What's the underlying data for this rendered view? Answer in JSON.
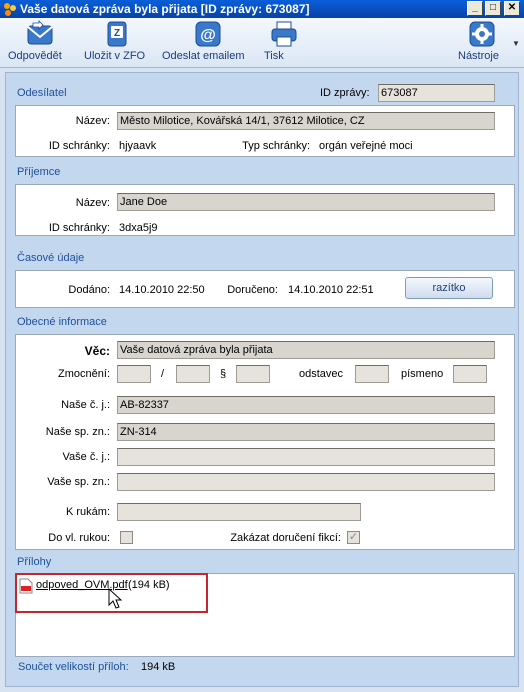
{
  "window": {
    "title": "Vaše datová zpráva byla přijata [ID zprávy: 673087]"
  },
  "toolbar": {
    "reply_label": "Odpovědět",
    "save_zfo_label": "Uložit v ZFO",
    "send_email_label": "Odeslat emailem",
    "print_label": "Tisk",
    "tools_label": "Nástroje"
  },
  "sender": {
    "section_label": "Odesílatel",
    "id_label": "ID zprávy:",
    "id_value": "673087",
    "name_label": "Název:",
    "name_value": "Město Milotice, Kovářská 14/1, 37612 Milotice, CZ",
    "box_label": "ID schránky:",
    "box_value": "hjyaavk",
    "box_type_label": "Typ schránky:",
    "box_type_value": "orgán veřejné moci"
  },
  "recipient": {
    "section_label": "Příjemce",
    "name_label": "Název:",
    "name_value": "Jane Doe",
    "box_label": "ID schránky:",
    "box_value": "3dxa5j9"
  },
  "time": {
    "section_label": "Časové údaje",
    "delivered_label": "Dodáno:",
    "delivered_value": "14.10.2010 22:50",
    "received_label": "Doručeno:",
    "received_value": "14.10.2010 22:51",
    "stamp_button": "razítko"
  },
  "general": {
    "section_label": "Obecné informace",
    "subject_label": "Věc:",
    "subject_value": "Vaše datová zpráva byla přijata",
    "authorization_label": "Zmocnění:",
    "slash": "/",
    "paragraph": "§",
    "subsection_label": "odstavec",
    "letter_label": "písmeno",
    "our_ref_label": "Naše č. j.:",
    "our_ref_value": "AB-82337",
    "our_file_label": "Naše sp. zn.:",
    "our_file_value": "ZN-314",
    "your_ref_label": "Vaše č. j.:",
    "your_file_label": "Vaše sp. zn.:",
    "attn_label": "K rukám:",
    "personal_label": "Do vl. rukou:",
    "fiction_label": "Zakázat doručení fikcí:"
  },
  "attachments": {
    "section_label": "Přílohy",
    "files": [
      {
        "name": "odpoved_OVM.pdf",
        "size": "(194 kB)"
      }
    ],
    "total_label": "Součet velikostí příloh:",
    "total_value": "194 kB"
  }
}
